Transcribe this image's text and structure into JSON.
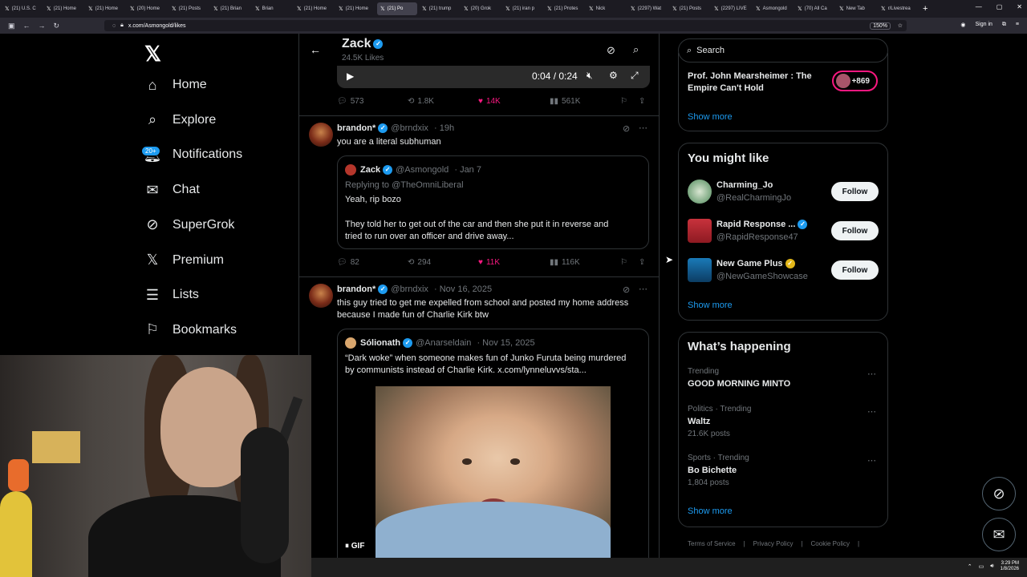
{
  "browser": {
    "tabs": [
      {
        "label": "(21) U.S. C",
        "active": false
      },
      {
        "label": "(21) Home",
        "active": false
      },
      {
        "label": "(21) Home",
        "active": false
      },
      {
        "label": "(20) Home",
        "active": false
      },
      {
        "label": "(21) Posts",
        "active": false
      },
      {
        "label": "(21) Brian",
        "active": false
      },
      {
        "label": "Brian",
        "active": false
      },
      {
        "label": "(21) Home",
        "active": false
      },
      {
        "label": "(21) Home",
        "active": false
      },
      {
        "label": "(21) Po",
        "active": true
      },
      {
        "label": "(21) trump",
        "active": false
      },
      {
        "label": "(20) Grok",
        "active": false
      },
      {
        "label": "(21) iran p",
        "active": false
      },
      {
        "label": "(21) Protes",
        "active": false
      },
      {
        "label": "Nick",
        "active": false
      },
      {
        "label": "(2297) Wat",
        "active": false
      },
      {
        "label": "(21) Posts",
        "active": false
      },
      {
        "label": "(2297) LIVE",
        "active": false
      },
      {
        "label": "Asmongold",
        "active": false
      },
      {
        "label": "(70) All Ca",
        "active": false
      },
      {
        "label": "New Tab",
        "active": false
      },
      {
        "label": "r/Livestrea",
        "active": false
      }
    ],
    "url": "x.com/Asmongold/likes",
    "zoom": "150%",
    "sign_in": "Sign in"
  },
  "nav": {
    "items": [
      {
        "label": "Home",
        "icon": "home-icon"
      },
      {
        "label": "Explore",
        "icon": "search-icon"
      },
      {
        "label": "Notifications",
        "icon": "bell-icon"
      },
      {
        "label": "Chat",
        "icon": "mail-icon"
      },
      {
        "label": "SuperGrok",
        "icon": "grok-icon"
      },
      {
        "label": "Premium",
        "icon": "x-icon"
      },
      {
        "label": "Lists",
        "icon": "list-icon"
      },
      {
        "label": "Bookmarks",
        "icon": "bookmark-icon"
      }
    ],
    "notif_badge": "20+"
  },
  "header": {
    "name": "Zack",
    "likes": "24.5K Likes"
  },
  "video": {
    "time": "0:04 / 0:24"
  },
  "tweet0_actions": {
    "replies": "573",
    "reposts": "1.8K",
    "likes": "14K",
    "views": "561K"
  },
  "tweet1": {
    "name": "brandon*",
    "handle": "@brndxix",
    "time": "· 19h",
    "text": "you are a literal subhuman",
    "quote": {
      "name": "Zack",
      "handle": "@Asmongold",
      "time": "· Jan 7",
      "replying": "Replying to @TheOmniLiberal",
      "line1": "Yeah, rip bozo",
      "line2": "They told her to get out of the car and then she put it in reverse and",
      "line3": "tried to run over an officer and drive away..."
    },
    "actions": {
      "replies": "82",
      "reposts": "294",
      "likes": "11K",
      "views": "116K"
    }
  },
  "tweet2": {
    "name": "brandon*",
    "handle": "@brndxix",
    "time": "· Nov 16, 2025",
    "line1": "this guy tried to get me expelled from school and posted my home address",
    "line2": "because I made fun of Charlie Kirk btw",
    "quote": {
      "name": "Sólionath",
      "handle": "@Anarseldain",
      "time": "· Nov 15, 2025",
      "line1": "“Dark woke” when someone makes fun of Junko Furuta being murdered",
      "line2": "by communists instead of Charlie Kirk.  x.com/lynneluvvs/sta...",
      "gif": "GIF"
    }
  },
  "right": {
    "search_placeholder": "Search",
    "space_title": "Prof. John Mearsheimer : The Empire Can't Hold",
    "space_count": "+869",
    "show_more": "Show more",
    "might_like_title": "You might like",
    "suggestions": [
      {
        "name": "Charming_Jo",
        "handle": "@RealCharmingJo",
        "follow": "Follow"
      },
      {
        "name": "Rapid Response ...",
        "handle": "@RapidResponse47",
        "follow": "Follow"
      },
      {
        "name": "New Game Plus",
        "handle": "@NewGameShowcase",
        "follow": "Follow"
      }
    ],
    "happening_title": "What’s happening",
    "trends": [
      {
        "category": "Trending",
        "name": "GOOD MORNING MINTO",
        "posts": ""
      },
      {
        "category": "Politics · Trending",
        "name": "Waltz",
        "posts": "21.6K posts"
      },
      {
        "category": "Sports · Trending",
        "name": "Bo Bichette",
        "posts": "1,804 posts"
      }
    ],
    "footer": [
      "Terms of Service",
      "|",
      "Privacy Policy",
      "|",
      "Cookie Policy",
      "|"
    ]
  },
  "taskbar": {
    "time": "3:29 PM",
    "date": "1/8/2026"
  }
}
